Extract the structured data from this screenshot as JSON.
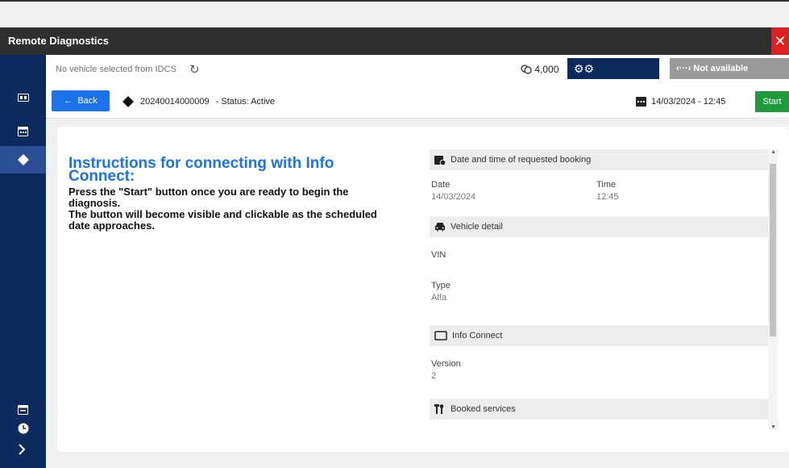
{
  "window": {
    "title": "Remote Diagnostics",
    "close_glyph": "✕"
  },
  "topbar": {
    "no_vehicle": "No vehicle selected from IDCS",
    "refresh_glyph": "↻",
    "credits_value": "4,000",
    "device_glyph": "⚙⚙",
    "status_glyph": "‹···›",
    "status_label": "Not available"
  },
  "subbar": {
    "back_label": "Back",
    "back_glyph": "←",
    "booking_id": "20240014000009",
    "status_text": "- Status: Active",
    "datetime": "14/03/2024 - 12:45",
    "start_label": "Start"
  },
  "instructions": {
    "title": "Instructions for connecting with Info Connect:",
    "line1": "Press the \"Start\" button once you are ready to begin the diagnosis.",
    "line2": "The button will become visible and clickable as the scheduled date approaches."
  },
  "booking_section": {
    "header": "Date and time of requested booking",
    "date_label": "Date",
    "date_value": "14/03/2024",
    "time_label": "Time",
    "time_value": "12:45"
  },
  "vehicle_section": {
    "header": "Vehicle detail",
    "vin_label": "VIN",
    "type_label": "Type",
    "type_value": "Alfa"
  },
  "infoconnect_section": {
    "header": "Info Connect",
    "version_label": "Version",
    "version_value": "2"
  },
  "services_section": {
    "header": "Booked services"
  },
  "colors": {
    "sidebar": "#0d2a5f",
    "accent": "#1a73e8",
    "start": "#1f9a3a",
    "close": "#e02020",
    "titlebar": "#2f2f2f"
  }
}
